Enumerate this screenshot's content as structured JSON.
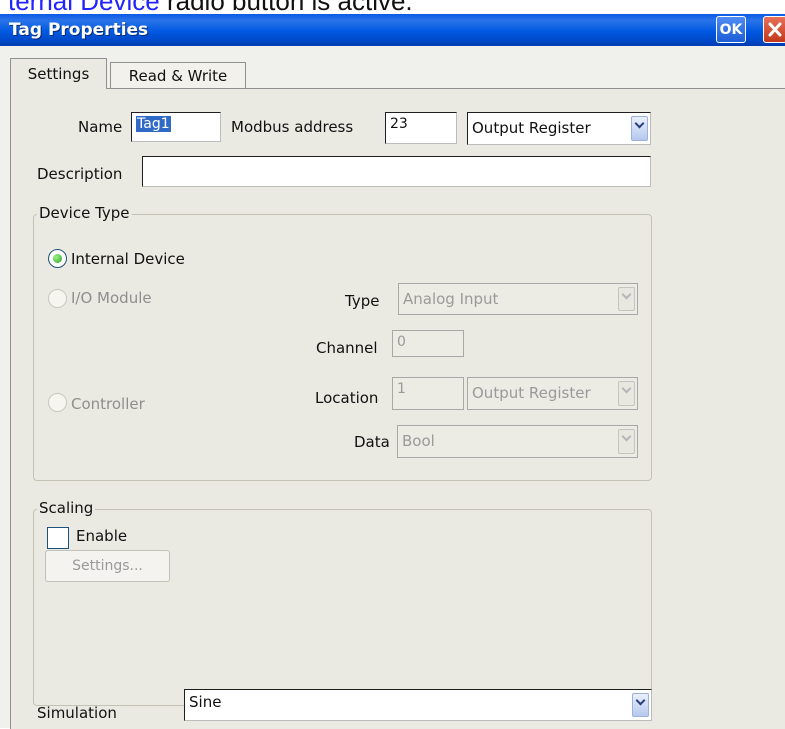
{
  "caption": {
    "highlight": "ternal Device",
    "rest": " radio button is active."
  },
  "window": {
    "title": "Tag Properties",
    "ok_label": "OK"
  },
  "tabs": [
    {
      "label": "Settings"
    },
    {
      "label": "Read & Write"
    }
  ],
  "form": {
    "name_label": "Name",
    "name_value": "Tag1",
    "modbus_label": "Modbus address",
    "modbus_value": "23",
    "register_type": "Output Register",
    "description_label": "Description",
    "description_value": ""
  },
  "device_type": {
    "legend": "Device Type",
    "internal": "Internal Device",
    "io_module": "I/O Module",
    "controller": "Controller",
    "selected": "Internal Device",
    "type_label": "Type",
    "type_value": "Analog Input",
    "channel_label": "Channel",
    "channel_value": "0",
    "location_label": "Location",
    "location_value": "1",
    "location_register": "Output Register",
    "data_label": "Data",
    "data_value": "Bool"
  },
  "scaling": {
    "legend": "Scaling",
    "enable_label": "Enable",
    "enable_checked": false,
    "settings_label": "Settings..."
  },
  "simulation": {
    "label": "Simulation",
    "value": "Sine"
  },
  "colors": {
    "titlebar": "#0058e0",
    "panel": "#ebeae2",
    "radio_selected": "#2aa41c"
  }
}
